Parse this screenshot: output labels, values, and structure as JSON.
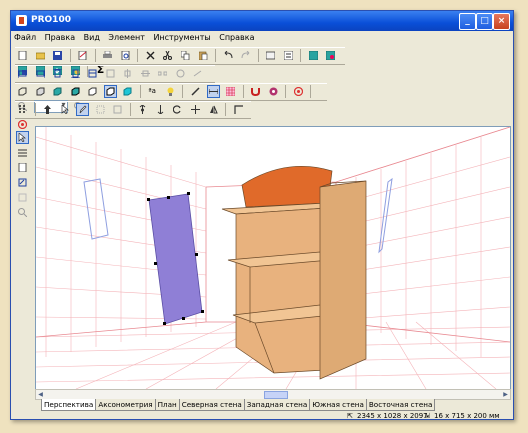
{
  "window": {
    "title": "PRO100"
  },
  "menu": [
    "Файл",
    "Правка",
    "Вид",
    "Элемент",
    "Инструменты",
    "Справка"
  ],
  "toolbar": {
    "zoom_value": "",
    "sigma_label": "Σ",
    "text_tool_label": "ªa"
  },
  "tabs": [
    "Перспектива",
    "Аксонометрия",
    "План",
    "Северная стена",
    "Западная стена",
    "Южная стена",
    "Восточная стена"
  ],
  "status": {
    "room_size": "2345 x 1028 x 2097",
    "element_size": "16 x 715 x 200",
    "units": "мм"
  },
  "colors": {
    "wood": "#e8b27e",
    "top_panel": "#e06a2a",
    "door_panel": "#8f7fd6",
    "grid": "#f0a8ae"
  }
}
